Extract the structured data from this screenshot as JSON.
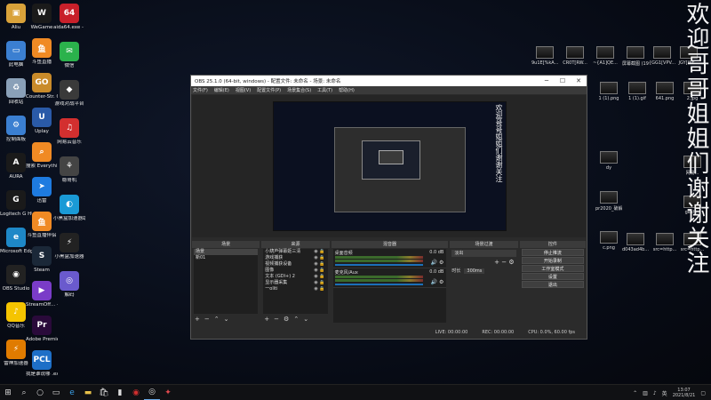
{
  "desktop_icons_col1": [
    {
      "label": "Aliu",
      "color": "#d9a23a",
      "glyph": "▣"
    },
    {
      "label": "此电脑",
      "color": "#3b7fd1",
      "glyph": "▭"
    },
    {
      "label": "回收站",
      "color": "#8aa0b8",
      "glyph": "♻"
    },
    {
      "label": "控制面板",
      "color": "#3b7fd1",
      "glyph": "⚙"
    },
    {
      "label": "AURA",
      "color": "#1a1a1a",
      "glyph": "A"
    },
    {
      "label": "Logitech G HUB",
      "color": "#1a1a1a",
      "glyph": "G"
    },
    {
      "label": "Microsoft Edge",
      "color": "#1e88c7",
      "glyph": "e"
    },
    {
      "label": "OBS Studio",
      "color": "#222222",
      "glyph": "◉"
    },
    {
      "label": "QQ音乐",
      "color": "#f5c400",
      "glyph": "♪"
    },
    {
      "label": "雷神加速器",
      "color": "#e07b00",
      "glyph": "⚡"
    }
  ],
  "desktop_icons_col2": [
    {
      "label": "WeGame",
      "color": "#1a1a1a",
      "glyph": "W"
    },
    {
      "label": "斗鱼直播",
      "color": "#f08a24",
      "glyph": "鱼"
    },
    {
      "label": "Counter-Str. Global Offe...",
      "color": "#c98b2a",
      "glyph": "GO"
    },
    {
      "label": "Uplay",
      "color": "#2a5aa8",
      "glyph": "U"
    },
    {
      "label": "搜索 Everything",
      "color": "#f08a24",
      "glyph": "⌕"
    },
    {
      "label": "迅雷",
      "color": "#1e7be0",
      "glyph": "➤"
    },
    {
      "label": "斗鱼直播伴侣",
      "color": "#f08a24",
      "glyph": "鱼"
    },
    {
      "label": "Steam",
      "color": "#1b2838",
      "glyph": "S"
    },
    {
      "label": "StreamOff... - 快捷方式",
      "color": "#7a3cc8",
      "glyph": "▶"
    },
    {
      "label": "Adobe Premie...",
      "color": "#2a0a3a",
      "glyph": "Pr"
    },
    {
      "label": "我是谁说哪 .exe - 快捷...",
      "color": "#1e6fc7",
      "glyph": "PCL"
    }
  ],
  "desktop_icons_col3": [
    {
      "label": "aida64.exe - 快捷方式",
      "color": "#c8202a",
      "glyph": "64"
    },
    {
      "label": "微信",
      "color": "#2bb24c",
      "glyph": "✉"
    },
    {
      "label": "游戏对战平台",
      "color": "#3a3a3a",
      "glyph": "◆"
    },
    {
      "label": "网易云音乐",
      "color": "#d32f2f",
      "glyph": "♫"
    },
    {
      "label": "稳哥机",
      "color": "#444444",
      "glyph": "⚘"
    },
    {
      "label": "小黑盒加速器助手",
      "color": "#1a9ad6",
      "glyph": "◐"
    },
    {
      "label": "小黑盒加速器",
      "color": "#222222",
      "glyph": "⚡"
    },
    {
      "label": "解码",
      "color": "#6a5acd",
      "glyph": "◎"
    }
  ],
  "file_thumbs": [
    {
      "label": "9u1E[%kA..."
    },
    {
      "label": "CR0T[RW..."
    },
    {
      "label": "~{A1]QE..."
    },
    {
      "label": "屏幕截图 (19).png"
    },
    {
      "label": "{GG1[VPV..."
    },
    {
      "label": "JGY[WE..."
    },
    {
      "label": "1 (1).png"
    },
    {
      "label": "1 (1).gif"
    },
    {
      "label": "641.png"
    },
    {
      "label": "2.jpg"
    },
    {
      "label": "dy"
    },
    {
      "label": "网易..."
    },
    {
      "label": "pr2020_破解.zip"
    },
    {
      "label": "gesh..."
    },
    {
      "label": "c.png"
    },
    {
      "label": "d043ad4b..."
    },
    {
      "label": "src=http..."
    },
    {
      "label": "src=http..."
    }
  ],
  "banner_text": "欢迎哥哥姐姐们谢谢关注",
  "obs": {
    "title": "OBS 25.1.0 (64-bit, windows) - 配置文件: 未命名 - 场景: 未命名",
    "menu": [
      "文件(F)",
      "编辑(E)",
      "视图(V)",
      "配置文件(P)",
      "场景集合(S)",
      "工具(T)",
      "帮助(H)"
    ],
    "docks": {
      "scenes": {
        "title": "场景",
        "items": [
          "场景",
          "新01"
        ]
      },
      "sources": {
        "title": "来源",
        "items": [
          "小葫芦弹幕姬三清",
          "游戏捕获",
          "视频捕获设备",
          "图像",
          "文本 (GDI+) 2",
          "显示器采集",
          "一oliti"
        ]
      },
      "mixer": {
        "title": "混音器",
        "tracks": [
          {
            "name": "桌面音频",
            "db": "0.0 dB"
          },
          {
            "name": "麦克风/Aux",
            "db": "0.0 dB"
          }
        ]
      },
      "transitions": {
        "title": "场景过渡",
        "selected": "淡出",
        "duration_label": "时长",
        "duration_value": "300ms"
      },
      "controls": {
        "title": "控件",
        "buttons": [
          "停止推流",
          "开始录制",
          "工作室模式",
          "设置",
          "退出"
        ]
      }
    },
    "status": {
      "live": "LIVE: 00:00:00",
      "rec": "REC: 00:00:00",
      "cpu": "CPU: 0.0%, 60.00 fps"
    }
  },
  "taskbar": {
    "time": "13:07",
    "date": "2021/8/21",
    "lang": "英"
  }
}
